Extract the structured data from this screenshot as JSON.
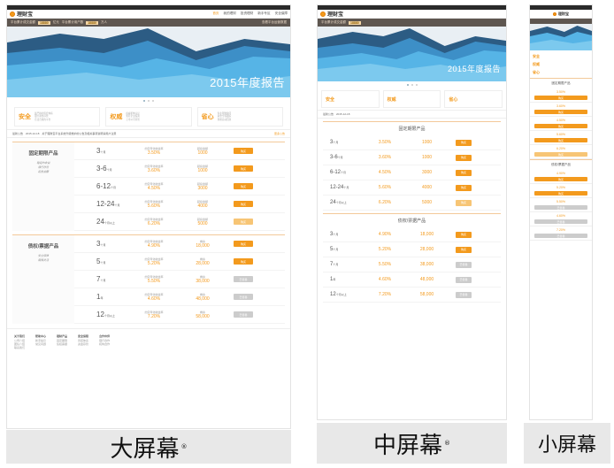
{
  "large": {
    "logo": "理财宝",
    "nav": [
      "首页",
      "我的理财",
      "投资理财",
      "新手专区",
      "安全保障"
    ],
    "strip": {
      "pre": "平台累计成交金额",
      "n1": "18880",
      "u1": "亿元",
      "mid": "平台累计用户数",
      "n2": "18880",
      "u2": "万人",
      "right": "查看平台运营数据"
    },
    "hero_text": "2015年度报告",
    "features": [
      {
        "title": "安全",
        "desc": [
          "最严格的风控体系",
          "银行资金存管",
          "合法合规的平台"
        ]
      },
      {
        "title": "权威",
        "desc": [
          "权威机构认证",
          "知名企业投资",
          "上市公司背景"
        ]
      },
      {
        "title": "省心",
        "desc": [
          "专业理财顾问",
          "资金全程跟踪",
          "到期自动回款"
        ]
      }
    ],
    "announce": {
      "label": "最新公告",
      "date": "2015-12-18",
      "text": "关于理财宝平台系统升级维护的公告及相关事项说明请用户注意",
      "more": "更多公告"
    },
    "group1": {
      "title": "固定期限产品",
      "sub": [
        "稳定的收益",
        "银行存管",
        "起投金额"
      ],
      "rows": [
        {
          "term": "3",
          "unit": "个月",
          "rate_label": "约定年化收益率",
          "rate": "3.50%",
          "amt_label": "起投金额",
          "amt": "1000",
          "btn": "购买",
          "style": "orange"
        },
        {
          "term": "3-6",
          "unit": "个月",
          "rate_label": "约定年化收益率",
          "rate": "3.60%",
          "amt_label": "起投金额",
          "amt": "1000",
          "btn": "购买",
          "style": "orange"
        },
        {
          "term": "6-12",
          "unit": "个月",
          "rate_label": "约定年化收益率",
          "rate": "4.50%",
          "amt_label": "起投金额",
          "amt": "3000",
          "btn": "购买",
          "style": "orange"
        },
        {
          "term": "12-24",
          "unit": "个月",
          "rate_label": "约定年化收益率",
          "rate": "5.60%",
          "amt_label": "起投金额",
          "amt": "4000",
          "btn": "购买",
          "style": "orange"
        },
        {
          "term": "24",
          "unit": "个月以上",
          "rate_label": "约定年化收益率",
          "rate": "6.20%",
          "amt_label": "起投金额",
          "amt": "5000",
          "btn": "购买",
          "style": "light"
        }
      ]
    },
    "group2": {
      "title": "债权/票据产品",
      "sub": [
        "安全保障",
        "期限灵活"
      ],
      "rows": [
        {
          "term": "3",
          "unit": "个月",
          "rate_label": "约定年化收益率",
          "rate": "4.90%",
          "amt_label": "剩余",
          "amt": "18,000",
          "btn": "购买",
          "style": "orange"
        },
        {
          "term": "5",
          "unit": "个月",
          "rate_label": "约定年化收益率",
          "rate": "5.20%",
          "amt_label": "剩余",
          "amt": "28,000",
          "btn": "购买",
          "style": "orange"
        },
        {
          "term": "7",
          "unit": "个月",
          "rate_label": "约定年化收益率",
          "rate": "5.50%",
          "amt_label": "剩余",
          "amt": "38,000",
          "btn": "已售罄",
          "style": "gray"
        },
        {
          "term": "1",
          "unit": "年",
          "rate_label": "约定年化收益率",
          "rate": "4.60%",
          "amt_label": "剩余",
          "amt": "48,000",
          "btn": "已售罄",
          "style": "gray"
        },
        {
          "term": "12",
          "unit": "个月以上",
          "rate_label": "约定年化收益率",
          "rate": "7.20%",
          "amt_label": "剩余",
          "amt": "58,000",
          "btn": "已售罄",
          "style": "gray"
        }
      ]
    },
    "footer": [
      {
        "h": "关于我们",
        "l": [
          "公司介绍",
          "团队介绍",
          "联系我们"
        ]
      },
      {
        "h": "帮助中心",
        "l": [
          "新手指引",
          "常见问题"
        ]
      },
      {
        "h": "理财产品",
        "l": [
          "固定期限",
          "债权票据"
        ]
      },
      {
        "h": "安全保障",
        "l": [
          "风控体系",
          "资金存管"
        ]
      },
      {
        "h": "合作伙伴",
        "l": [
          "银行合作",
          "机构合作"
        ]
      }
    ]
  },
  "captions": {
    "large": "大屏幕",
    "medium": "中屏幕",
    "small": "小屏幕",
    "registered": "®"
  }
}
